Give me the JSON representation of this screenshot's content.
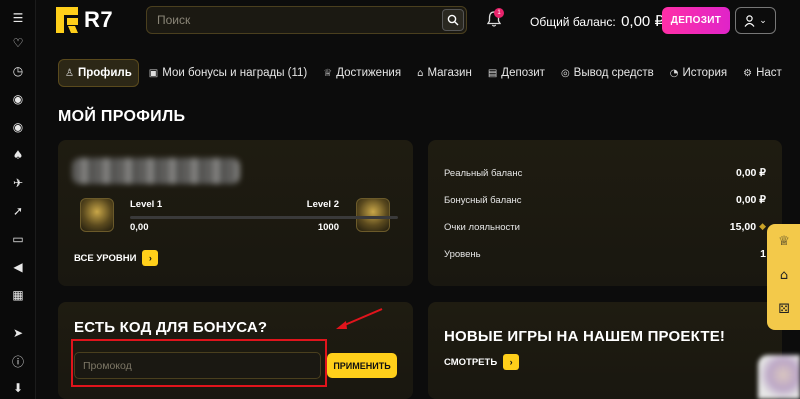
{
  "header": {
    "logo_text": "R7",
    "search_placeholder": "Поиск",
    "notification_count": "1",
    "balance_label": "Общий баланс:",
    "balance_value": "0,00 ₽",
    "deposit_label": "ДЕПОЗИТ",
    "user_icon": "user-icon"
  },
  "tabs": [
    {
      "label": "Профиль",
      "icon": "user-icon"
    },
    {
      "label": "Мои бонусы и награды (11)",
      "icon": "gift-icon"
    },
    {
      "label": "Достижения",
      "icon": "trophy-icon"
    },
    {
      "label": "Магазин",
      "icon": "store-icon"
    },
    {
      "label": "Депозит",
      "icon": "wallet-icon"
    },
    {
      "label": "Вывод средств",
      "icon": "coins-icon"
    },
    {
      "label": "История",
      "icon": "history-icon"
    },
    {
      "label": "Наст",
      "icon": "gear-icon"
    }
  ],
  "page_title": "МОЙ ПРОФИЛЬ",
  "profile": {
    "level_current_label": "Level 1",
    "level_next_label": "Level 2",
    "points_current": "0,00",
    "points_target": "1000",
    "progress_fraction": 0,
    "all_levels_label": "ВСЕ УРОВНИ"
  },
  "balances": [
    {
      "label": "Реальный баланс",
      "value": "0,00 ₽"
    },
    {
      "label": "Бонусный баланс",
      "value": "0,00 ₽"
    },
    {
      "label": "Очки лояльности",
      "value": "15,00"
    },
    {
      "label": "Уровень",
      "value": "1"
    }
  ],
  "bonus": {
    "title": "ЕСТЬ КОД ДЛЯ БОНУСА?",
    "promo_placeholder": "Промокод",
    "apply_label": "ПРИМЕНИТЬ"
  },
  "games": {
    "title": "НОВЫЕ ИГРЫ НА НАШЕМ ПРОЕКТЕ!",
    "link_label": "СМОТРЕТЬ"
  },
  "colors": {
    "accent_yellow": "#ffcf1a",
    "deposit_pink": "#ff2fa6",
    "annotation_red": "#e0141c"
  }
}
